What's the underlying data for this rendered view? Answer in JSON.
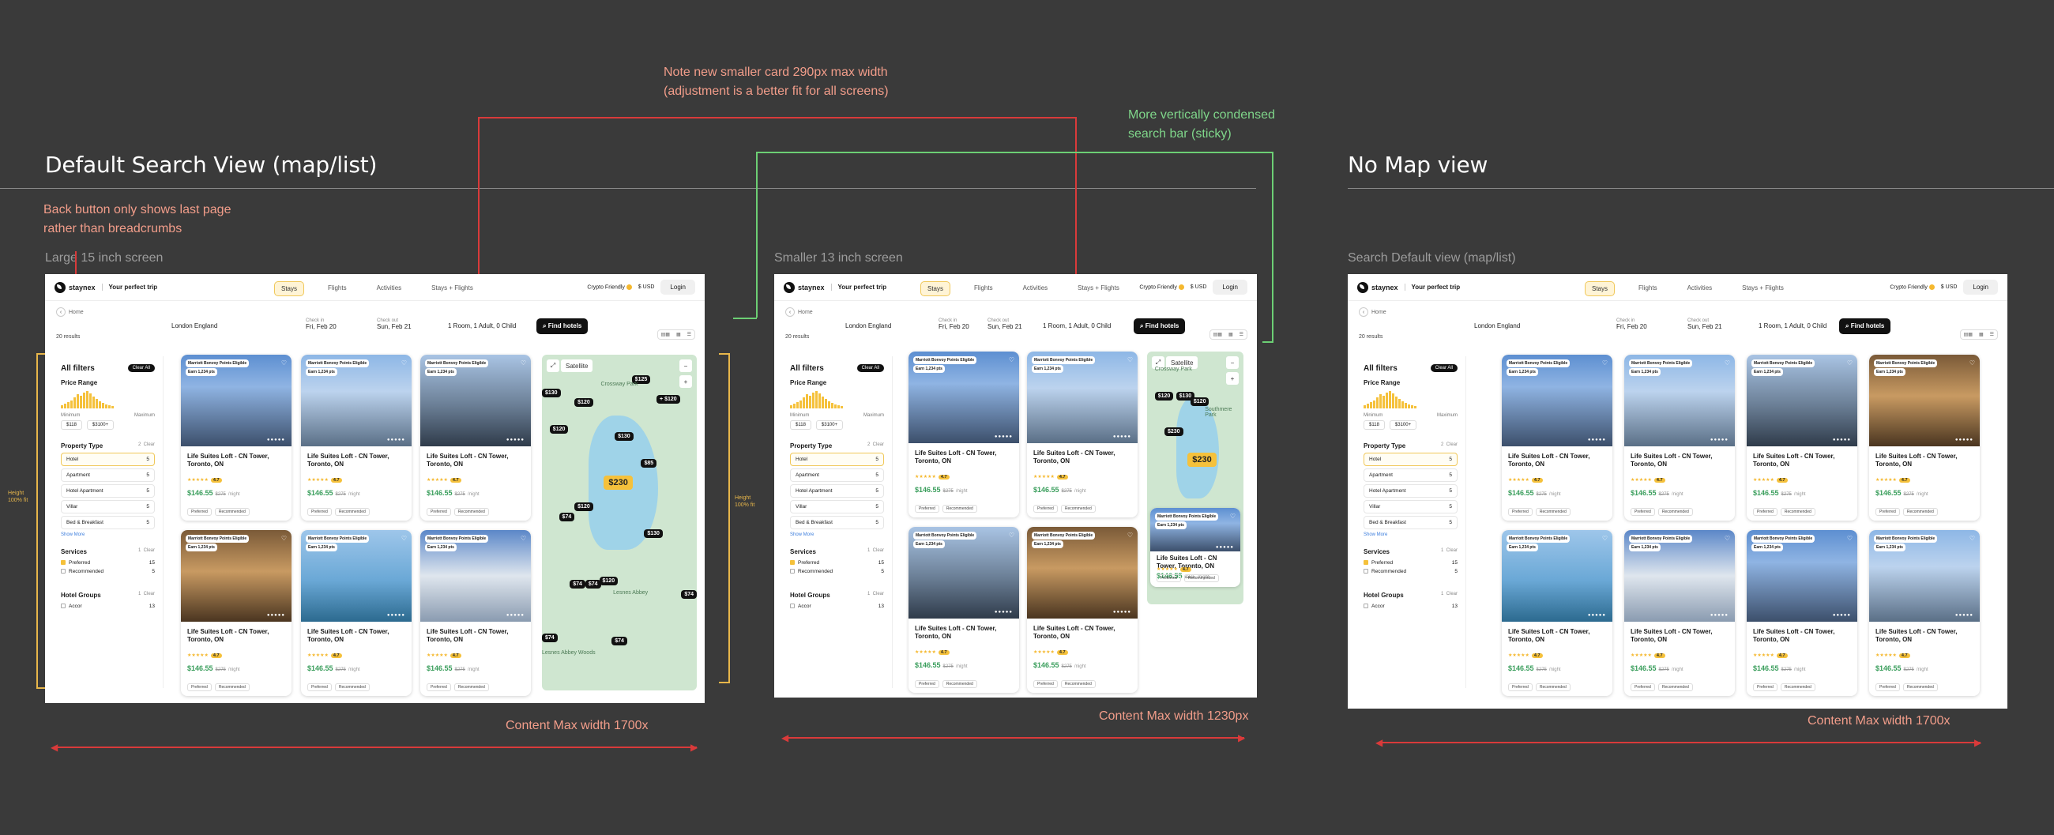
{
  "annotations": {
    "title_default": "Default Search View (map/list)",
    "title_nomap": "No Map view",
    "note_card": [
      "Note new smaller card 290px max width",
      "(adjustment is a better fit for all screens)"
    ],
    "note_searchbar": [
      "More vertically condensed",
      "search bar (sticky)"
    ],
    "note_back": [
      "Back button only shows last page",
      "rather than breadcrumbs"
    ],
    "label_large": "Large 15 inch screen",
    "label_small": "Smaller 13 inch screen",
    "label_nomap": "Search Default view (map/list)",
    "content_large": "Content Max width 1700x",
    "content_small": "Content Max width 1230px",
    "content_nomap": "Content Max width 1700x",
    "height_label": [
      "Height",
      "100% fit"
    ]
  },
  "nav": {
    "brand": "staynex",
    "tagline": "Your perfect trip",
    "tabs": [
      "Stays",
      "Flights",
      "Activities",
      "Stays + Flights"
    ],
    "active_tab": "Stays",
    "crypto": "Crypto Friendly",
    "currency": "$ USD",
    "login": "Login"
  },
  "search": {
    "back": "Home",
    "results": "20 results",
    "location": "London England",
    "checkin_label": "Check in",
    "checkin": "Fri, Feb 20",
    "checkout_label": "Check out",
    "checkout": "Sun, Feb 21",
    "guests": "1 Room, 1 Adult, 0 Child",
    "find": "Find hotels"
  },
  "filters": {
    "title": "All filters",
    "clear_all": "Clear All",
    "price_range": "Price Range",
    "minimum": "Minimum",
    "maximum": "Maximum",
    "min_value": "$118",
    "max_value": "$3100+",
    "property_type": "Property Type",
    "property_count": "2",
    "clear": "Clear",
    "property_items": [
      {
        "label": "Hotel",
        "count": "5"
      },
      {
        "label": "Apartment",
        "count": "5"
      },
      {
        "label": "Hotel Apartment",
        "count": "5"
      },
      {
        "label": "Villar",
        "count": "5"
      },
      {
        "label": "Bed & Breakfast",
        "count": "5"
      }
    ],
    "show_more": "Show More",
    "services": "Services",
    "services_count": "1",
    "services_items": [
      {
        "label": "Preferred",
        "count": "15"
      },
      {
        "label": "Recommended",
        "count": "5"
      }
    ],
    "hotel_groups": "Hotel Groups",
    "hotel_groups_count": "1",
    "hotel_group_item": "Accor",
    "hotel_group_count": "13"
  },
  "card": {
    "badge1": "Marriott Bonvoy Points Eligible",
    "badge2": "Earn 1,234 pts",
    "title": "Life Suites Loft - CN Tower, Toronto, ON",
    "stars": "★★★★★",
    "score": "4.7",
    "price": "$146.55",
    "old_price": "$275",
    "per": "/night",
    "tag1": "Preferred",
    "tag2": "Recommended"
  },
  "map": {
    "satellite": "Satellite",
    "pins": [
      "$125",
      "+ $120",
      "$130",
      "$120",
      "$120",
      "$130",
      "$230",
      "$85",
      "$120",
      "$74",
      "$130",
      "$74",
      "$74",
      "$120",
      "$74",
      "$74",
      "$74"
    ],
    "big_pin": "$230",
    "labels": [
      "Crossway Park",
      "Lesnes Abbey",
      "Lesnes Abbey Woods",
      "Southmere Park"
    ]
  },
  "colors": {
    "background": "#3a3a3a",
    "accent": "#f5c13b",
    "price_green": "#3a9e5c",
    "note_red": "#f29d8a",
    "note_green": "#7fd68a",
    "height_yellow": "#e7b64a"
  }
}
